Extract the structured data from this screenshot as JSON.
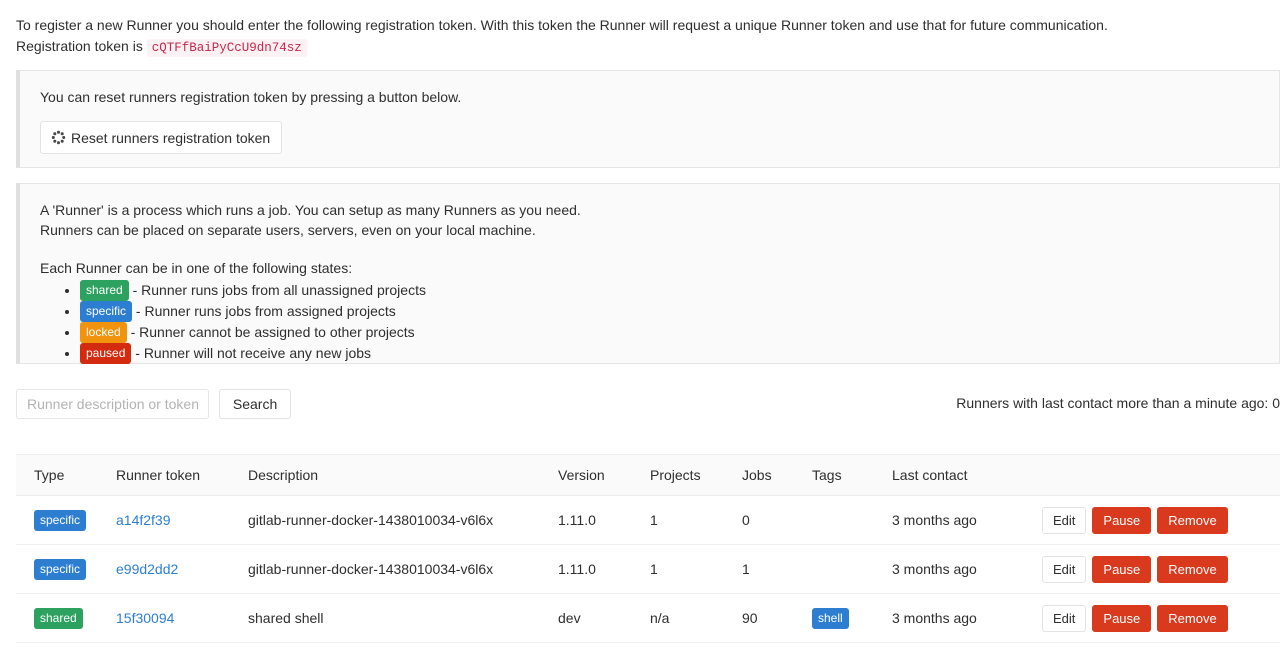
{
  "intro": {
    "line1": "To register a new Runner you should enter the following registration token. With this token the Runner will request a unique Runner token and use that for future communication.",
    "line2_prefix": "Registration token is",
    "registration_token": "cQTFfBaiPyCcU9dn74sz"
  },
  "reset_panel": {
    "text": "You can reset runners registration token by pressing a button below.",
    "button_label": "Reset runners registration token",
    "button_icon": "spinner-icon"
  },
  "info_panel": {
    "line1": "A 'Runner' is a process which runs a job. You can setup as many Runners as you need.",
    "line2": "Runners can be placed on separate users, servers, even on your local machine.",
    "states_lead": "Each Runner can be in one of the following states:",
    "states": [
      {
        "badge": "shared",
        "color": "#2ca160",
        "description": "- Runner runs jobs from all unassigned projects"
      },
      {
        "badge": "specific",
        "color": "#2d7ed0",
        "description": "- Runner runs jobs from assigned projects"
      },
      {
        "badge": "locked",
        "color": "#f2930d",
        "description": "- Runner cannot be assigned to other projects"
      },
      {
        "badge": "paused",
        "color": "#d22b0f",
        "description": "- Runner will not receive any new jobs"
      }
    ]
  },
  "search": {
    "placeholder": "Runner description or token",
    "value": "",
    "button_label": "Search",
    "contact_note": "Runners with last contact more than a minute ago: 0"
  },
  "table": {
    "headers": {
      "type": "Type",
      "token": "Runner token",
      "description": "Description",
      "version": "Version",
      "projects": "Projects",
      "jobs": "Jobs",
      "tags": "Tags",
      "last_contact": "Last contact",
      "actions": ""
    },
    "rows": [
      {
        "type": "specific",
        "type_color": "#2d7ed0",
        "token": "a14f2f39",
        "description": "gitlab-runner-docker-1438010034-v6l6x",
        "version": "1.11.0",
        "projects": "1",
        "jobs": "0",
        "tags": [],
        "last_contact": "3 months ago",
        "actions": {
          "edit": "Edit",
          "pause": "Pause",
          "remove": "Remove"
        }
      },
      {
        "type": "specific",
        "type_color": "#2d7ed0",
        "token": "e99d2dd2",
        "description": "gitlab-runner-docker-1438010034-v6l6x",
        "version": "1.11.0",
        "projects": "1",
        "jobs": "1",
        "tags": [],
        "last_contact": "3 months ago",
        "actions": {
          "edit": "Edit",
          "pause": "Pause",
          "remove": "Remove"
        }
      },
      {
        "type": "shared",
        "type_color": "#2ca160",
        "token": "15f30094",
        "description": "shared shell",
        "version": "dev",
        "projects": "n/a",
        "jobs": "90",
        "tags": [
          "shell"
        ],
        "last_contact": "3 months ago",
        "actions": {
          "edit": "Edit",
          "pause": "Pause",
          "remove": "Remove"
        }
      }
    ]
  },
  "colors": {
    "link": "#2d7ed0",
    "danger": "#d9391c",
    "code_text": "#c7254e",
    "code_bg": "#fdf2f3",
    "panel_bg": "#fafafa"
  }
}
